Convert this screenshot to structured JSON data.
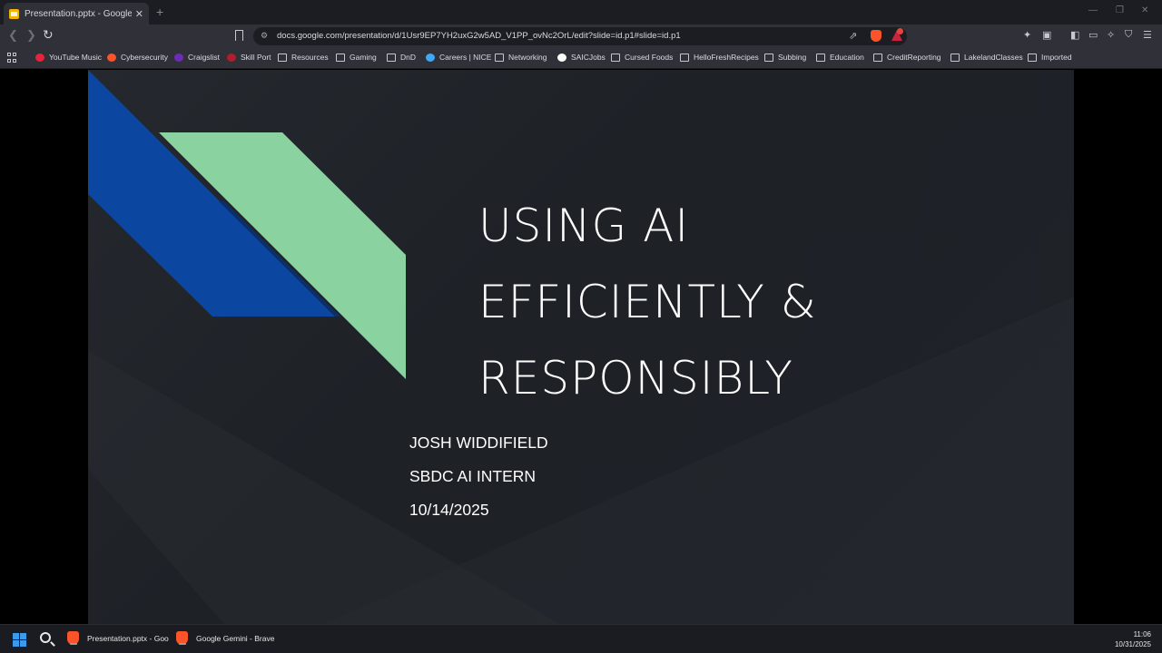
{
  "browser": {
    "tab_title": "Presentation.pptx - Google Slides",
    "tab_close": "✕",
    "new_tab": "+",
    "url": "docs.google.com/presentation/d/1Usr9EP7YH2uxG2w5AD_V1PP_ovNc2OrL/edit?slide=id.p1#slide=id.p1"
  },
  "bookmarks": [
    {
      "label": "YouTube Music",
      "icon": "youtube-music-icon",
      "color": "#e8223b"
    },
    {
      "label": "Cybersecurity",
      "icon": "brave-icon",
      "color": "#fb542b"
    },
    {
      "label": "Craigslist",
      "icon": "craigslist-icon",
      "color": "#6e2bb8"
    },
    {
      "label": "Skill Port",
      "icon": "skillport-icon",
      "color": "#b01d2b"
    },
    {
      "label": "Resources",
      "icon": "folder-icon"
    },
    {
      "label": "Gaming",
      "icon": "folder-icon"
    },
    {
      "label": "DnD",
      "icon": "folder-icon"
    },
    {
      "label": "Careers | NICE",
      "icon": "nice-icon",
      "color": "#3fa9f5"
    },
    {
      "label": "Networking",
      "icon": "folder-icon"
    },
    {
      "label": "SAICJobs",
      "icon": "saic-icon",
      "color": "#ffffff"
    },
    {
      "label": "Cursed Foods",
      "icon": "folder-icon"
    },
    {
      "label": "HelloFreshRecipes",
      "icon": "folder-icon"
    },
    {
      "label": "Subbing",
      "icon": "folder-icon"
    },
    {
      "label": "Education",
      "icon": "folder-icon"
    },
    {
      "label": "CreditReporting",
      "icon": "folder-icon"
    },
    {
      "label": "LakelandClasses",
      "icon": "folder-icon"
    },
    {
      "label": "Imported",
      "icon": "folder-icon"
    }
  ],
  "slide": {
    "title_lines": [
      "USING AI",
      "EFFICIENTLY &",
      "RESPONSIBLY"
    ],
    "subtitle_lines": [
      "JOSH WIDDIFIELD",
      "SBDC AI INTERN",
      "10/14/2025"
    ],
    "colors": {
      "blue": "#0b47a1",
      "green": "#8ad3a0",
      "background": "#1f2328",
      "text": "#ffffff"
    }
  },
  "taskbar": {
    "tasks": [
      {
        "label": "Presentation.pptx - Goo"
      },
      {
        "label": "Google Gemini - Brave"
      }
    ],
    "time": "11:06",
    "date": "10/31/2025"
  }
}
